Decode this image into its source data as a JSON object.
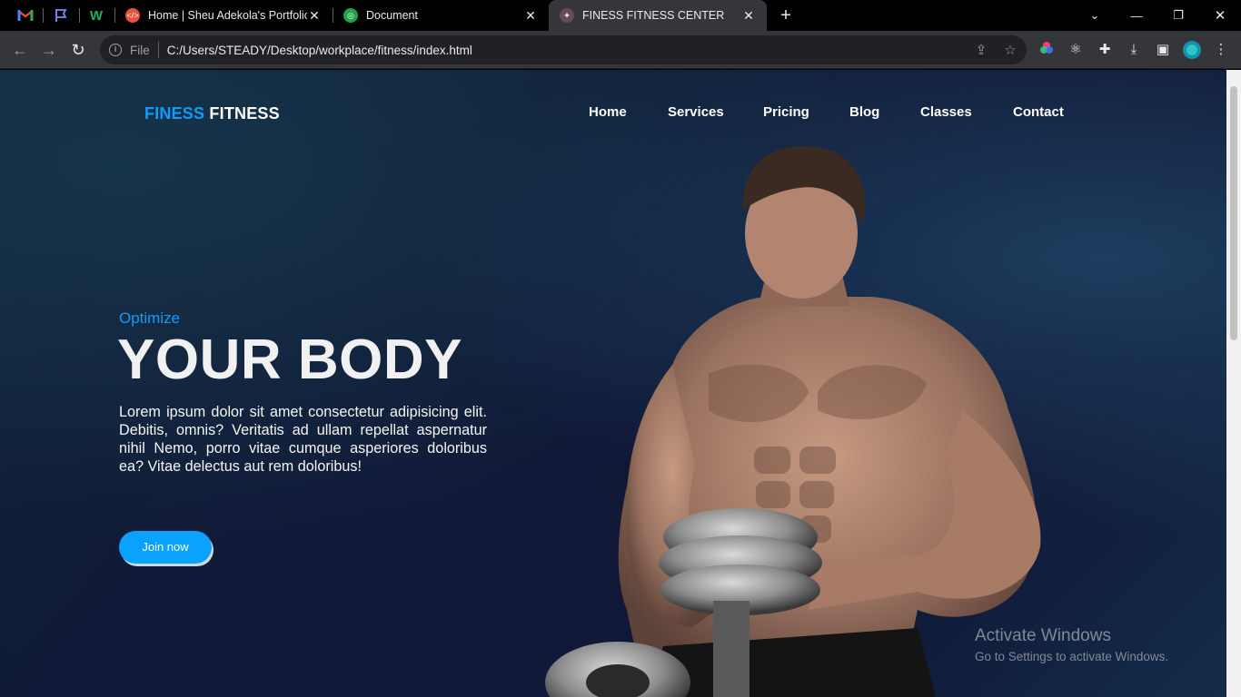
{
  "browser": {
    "tabs": [
      {
        "title": "Home | Sheu Adekola's Portfolio",
        "favicon": "code-icon"
      },
      {
        "title": "Document",
        "favicon": "document-icon"
      },
      {
        "title": "FINESS FITNESS CENTER",
        "favicon": "fitness-icon",
        "active": true
      }
    ],
    "pinned": [
      "gmail-icon",
      "flag-icon",
      "w-icon"
    ],
    "address": {
      "scheme_label": "File",
      "url": "C:/Users/STEADY/Desktop/workplace/fitness/index.html"
    }
  },
  "site": {
    "logo": {
      "part1": "FINESS",
      "part2": "FITNESS"
    },
    "nav": [
      "Home",
      "Services",
      "Pricing",
      "Blog",
      "Classes",
      "Contact"
    ]
  },
  "hero": {
    "subtitle": "Optimize",
    "title": "YOUR BODY",
    "text": "Lorem ipsum dolor sit amet consectetur adipisicing elit. Debitis, omnis? Veritatis ad ullam repellat aspernatur nihil Nemo, porro vitae cumque asperiores doloribus ea? Vitae delectus aut rem doloribus!",
    "cta": "Join now"
  },
  "watermark": {
    "line1": "Activate Windows",
    "line2": "Go to Settings to activate Windows."
  },
  "colors": {
    "accent": "#0f9bff",
    "button": "#0aa2ff",
    "chrome_bg": "#35363a"
  }
}
